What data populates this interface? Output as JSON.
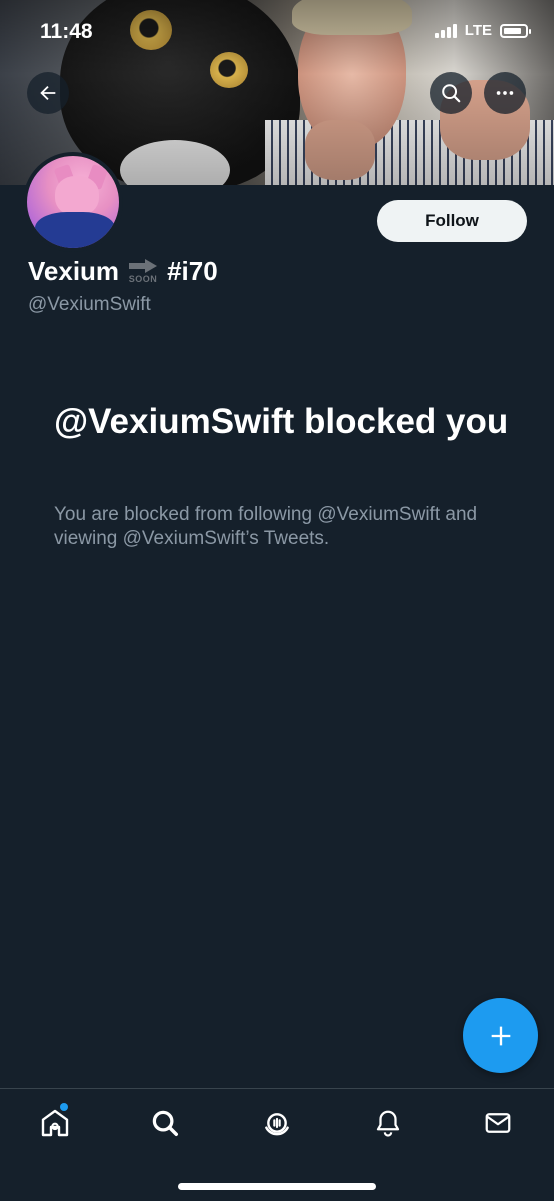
{
  "status_bar": {
    "time": "11:48",
    "network": "LTE",
    "battery_level": 0.85
  },
  "nav": {
    "back_icon": "arrow-left-icon",
    "search_icon": "search-icon",
    "more_icon": "more-horizontal-icon"
  },
  "profile": {
    "display_name": "Vexium",
    "emoji_text": "SOON",
    "name_suffix": "#i70",
    "handle": "@VexiumSwift",
    "follow_label": "Follow"
  },
  "blocked": {
    "title": "@VexiumSwift blocked you",
    "description": "You are blocked from following @VexiumSwift and viewing @VexiumSwift’s Tweets."
  },
  "fab": {
    "icon": "plus-icon"
  },
  "tabbar": {
    "items": [
      {
        "name": "home",
        "icon": "home-icon",
        "has_dot": true
      },
      {
        "name": "explore",
        "icon": "search-icon"
      },
      {
        "name": "spaces",
        "icon": "spaces-icon"
      },
      {
        "name": "notifications",
        "icon": "bell-icon"
      },
      {
        "name": "messages",
        "icon": "mail-icon"
      }
    ]
  },
  "colors": {
    "background": "#15202b",
    "accent": "#1d9bf0",
    "muted_text": "#8b98a5"
  }
}
